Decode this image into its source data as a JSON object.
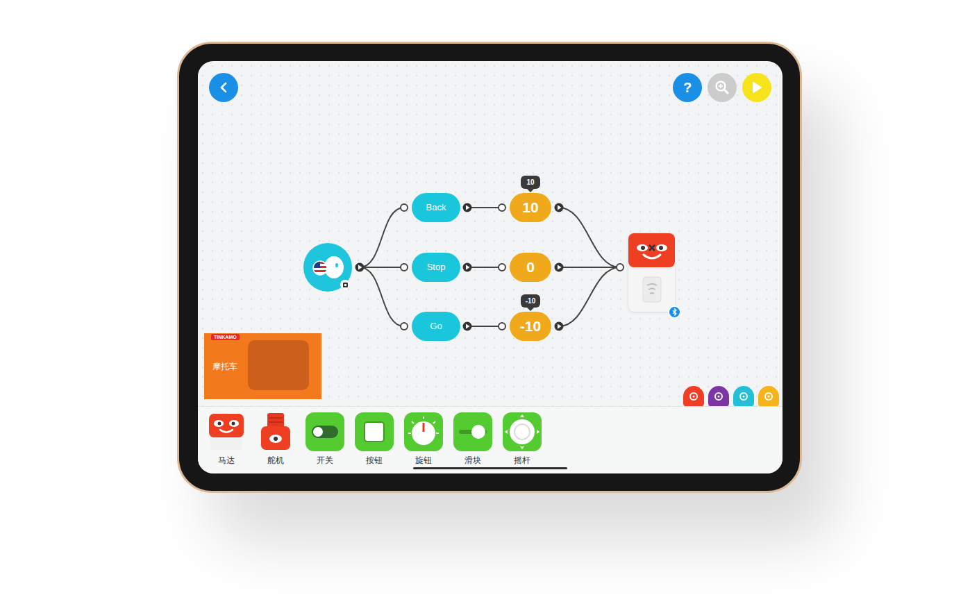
{
  "header": {
    "help_label": "?"
  },
  "commands": [
    {
      "label": "Back",
      "value": "10",
      "tooltip": "10"
    },
    {
      "label": "Stop",
      "value": "0",
      "tooltip": ""
    },
    {
      "label": "Go",
      "value": "-10",
      "tooltip": "-10"
    }
  ],
  "motor": {
    "bluetooth_connected": true
  },
  "project": {
    "brand": "TINKAMO",
    "title": "摩托车"
  },
  "categories": [
    {
      "color": "#ef3e24"
    },
    {
      "color": "#7b35a5"
    },
    {
      "color": "#22bfd6"
    },
    {
      "color": "#f5b41c"
    }
  ],
  "palette": [
    {
      "label": "马达",
      "kind": "motor"
    },
    {
      "label": "舵机",
      "kind": "servo"
    },
    {
      "label": "开关",
      "kind": "switch"
    },
    {
      "label": "按钮",
      "kind": "button"
    },
    {
      "label": "旋钮",
      "kind": "knob"
    },
    {
      "label": "滑块",
      "kind": "slider"
    },
    {
      "label": "摇杆",
      "kind": "joystick"
    }
  ]
}
